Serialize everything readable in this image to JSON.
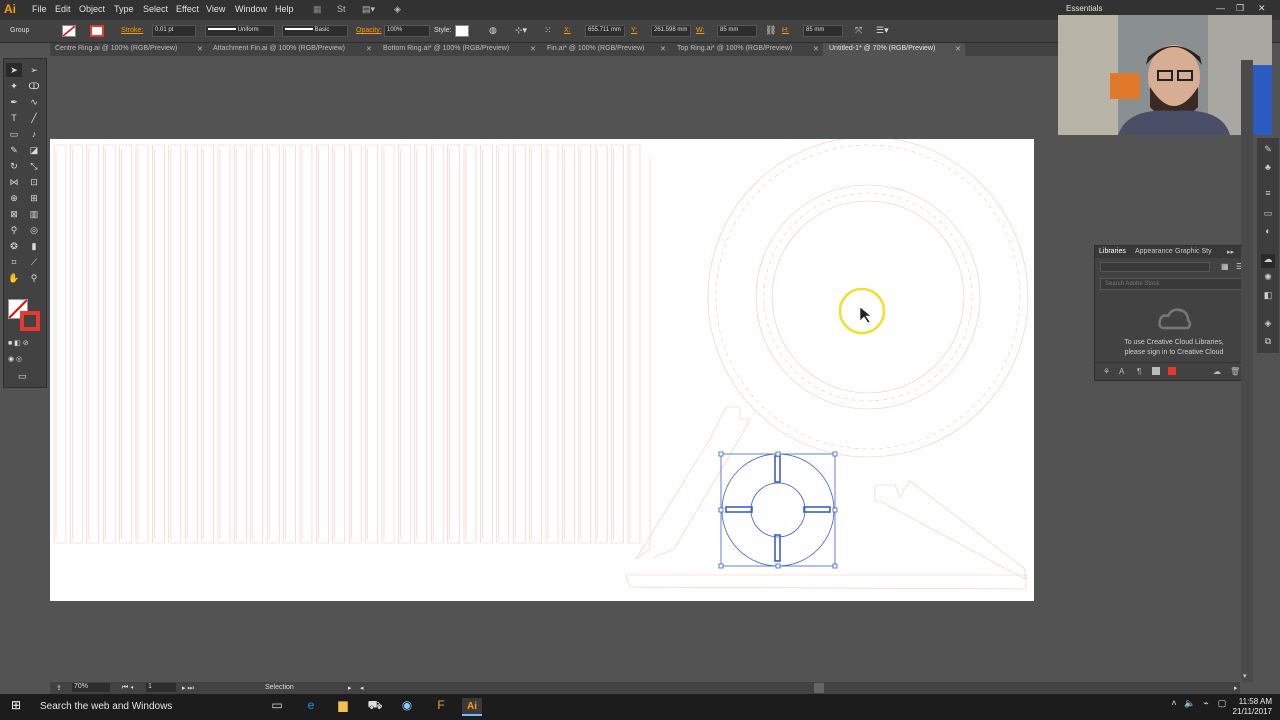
{
  "app": {
    "logo": "Ai",
    "menu": [
      "File",
      "Edit",
      "Object",
      "Type",
      "Select",
      "Effect",
      "View",
      "Window",
      "Help"
    ],
    "workspace": "Essentials",
    "window_controls": [
      "—",
      "❐",
      "✕"
    ]
  },
  "control_bar": {
    "selection": "Group",
    "stroke_label": "Stroke:",
    "stroke_weight": "0.01 pt",
    "profile": "Uniform",
    "brush": "Basic",
    "opacity_label": "Opacity:",
    "opacity": "100%",
    "style_label": "Style:",
    "x": "655.711 mm",
    "y": "261.598 mm",
    "w": "85 mm",
    "h": "85 mm"
  },
  "tabs": [
    {
      "label": "Centre Ring.ai @ 100% (RGB/Preview)",
      "active": false
    },
    {
      "label": "Attachment Fin.ai @ 100% (RGB/Preview)",
      "active": false
    },
    {
      "label": "Bottom Ring.ai* @ 100% (RGB/Preview)",
      "active": false
    },
    {
      "label": "Fin.ai* @ 100% (RGB/Preview)",
      "active": false
    },
    {
      "label": "Top Ring.ai* @ 100% (RGB/Preview)",
      "active": false
    },
    {
      "label": "Untitled-1* @ 70% (RGB/Preview)",
      "active": true
    }
  ],
  "libraries_panel": {
    "tabs": [
      "Libraries",
      "Appearance",
      "Graphic Sty"
    ],
    "search_placeholder": "Search Adobe Stock",
    "message_line1": "To use Creative Cloud Libraries,",
    "message_line2": "please sign in to Creative Cloud"
  },
  "status_bar": {
    "zoom": "70%",
    "artboard": "1",
    "tool": "Selection"
  },
  "taskbar": {
    "search": "Search the web and Windows",
    "time": "11:58 AM",
    "date": "21/11/2017"
  },
  "colors": {
    "cut_line": "#f3c7c0",
    "selection": "#3a5fcd",
    "cursor_highlight": "#f0e030",
    "stroke_swatch": "#e8382f"
  }
}
